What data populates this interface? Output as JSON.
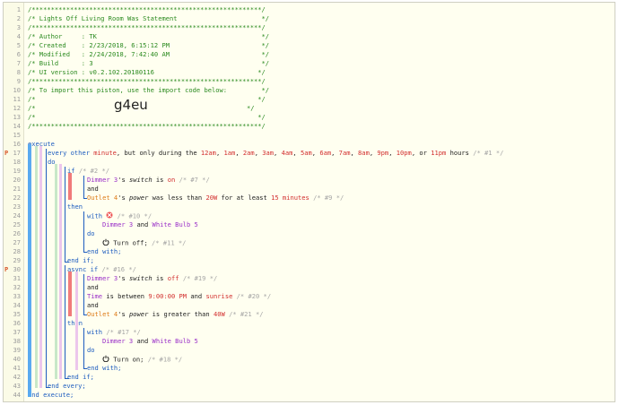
{
  "header": {
    "border": "/************************************************************/",
    "title": "/* Lights Off Living Room Was Statement                      */",
    "author": "/* Author     : TK                                           */",
    "created": "/* Created    : 2/23/2018, 6:15:12 PM                        */",
    "modified": "/* Modified   : 2/24/2018, 7:42:40 AM                        */",
    "build": "/* Build      : 3                                            */",
    "ui_version": "/* UI version : v0.2.102.20180116                           */",
    "import_text": "/* To import this piston, use the import code below:         */",
    "blank_a": "/*                                                          */",
    "blank_b": "/*                                                          */",
    "blank_c": "/*                                                          */",
    "import_code_prefix": "/*",
    "import_code_suffix": "*/",
    "import_code": "g4eu"
  },
  "code": {
    "execute": "execute",
    "every": "every",
    "other": "other",
    "minute": "minute",
    "only_during": ", but only during the",
    "hours_list": [
      {
        "t": "12am",
        "s": ", "
      },
      {
        "t": "1am",
        "s": ", "
      },
      {
        "t": "2am",
        "s": ", "
      },
      {
        "t": "3am",
        "s": ", "
      },
      {
        "t": "4am",
        "s": ", "
      },
      {
        "t": "5am",
        "s": ", "
      },
      {
        "t": "6am",
        "s": ", "
      },
      {
        "t": "7am",
        "s": ", "
      },
      {
        "t": "8am",
        "s": ", "
      },
      {
        "t": "9pm",
        "s": ", "
      },
      {
        "t": "10pm",
        "s": ", or "
      },
      {
        "t": "11pm",
        "s": ""
      }
    ],
    "hours_word": "hours",
    "c1": "/* #1 */",
    "do": "do",
    "if": "if",
    "c2": "/* #2 */",
    "dimmer3": "Dimmer 3",
    "switch_poss": "'s",
    "switch_word": "switch",
    "is": "is",
    "on": "on",
    "c7": "/* #7 */",
    "and": "and",
    "outlet4": "Outlet 4",
    "power_word": "power",
    "less_than": "was less than",
    "w20": "20W",
    "for_at_least": "for at least",
    "n15": "15",
    "minutes": "minutes",
    "c9": "/* #9 */",
    "then": "then",
    "with": "with",
    "c10": "/* #10 */",
    "and_word": "and",
    "white_bulb5": "White Bulb 5",
    "turn_off": "Turn off;",
    "c11": "/* #11 */",
    "end_with": "end with;",
    "end_if": "end if;",
    "async_if": "async if",
    "c16": "/* #16 */",
    "off": "off",
    "c19": "/* #19 */",
    "time_word": "Time",
    "between": "is between",
    "t900": "9:00:00 PM",
    "sunrise": "sunrise",
    "c20": "/* #20 */",
    "greater_than": "is greater than",
    "w40": "40W",
    "c21": "/* #21 */",
    "c17": "/* #17 */",
    "turn_on": "Turn on;",
    "c18": "/* #18 */",
    "end_every": "end every;",
    "end_execute": "end execute;"
  },
  "gutter": {
    "line_numbers": [
      "1",
      "2",
      "3",
      "4",
      "5",
      "6",
      "7",
      "8",
      "9",
      "10",
      "11",
      "12",
      "13",
      "14",
      "15",
      "16",
      "17",
      "18",
      "19",
      "20",
      "21",
      "22",
      "23",
      "24",
      "25",
      "26",
      "27",
      "28",
      "29",
      "30",
      "31",
      "32",
      "33",
      "34",
      "35",
      "36",
      "37",
      "38",
      "39",
      "40",
      "41",
      "42",
      "43",
      "44"
    ],
    "tag_17": "P",
    "tag_30": "P"
  },
  "colors": {
    "comment": "#2b8a1f",
    "keyword": "#1d5cbf",
    "value_red": "#d22e2e",
    "device_purple": "#9a2fc8",
    "number_orange": "#de7b18",
    "trace_blue": "#5aaaf0",
    "trace_red": "#f07a7a",
    "trace_pink": "#ecc6ec",
    "trace_green": "#c8e8c8"
  },
  "icons": {
    "lock_off": "lock-off-icon",
    "power_off": "power-icon",
    "power_on": "power-icon"
  }
}
